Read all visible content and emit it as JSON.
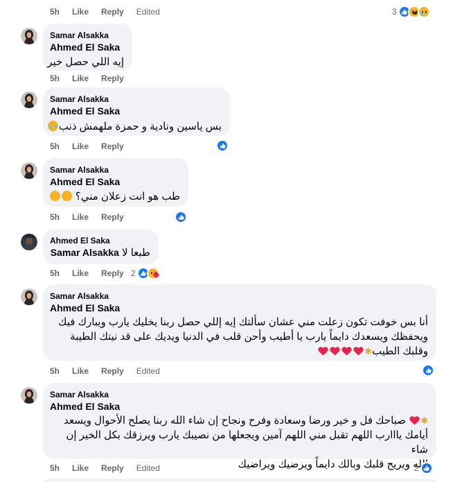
{
  "top_meta": {
    "time": "5h",
    "like": "Like",
    "reply": "Reply",
    "edited": "Edited",
    "count": "3"
  },
  "comments": [
    {
      "author": "Samar Alsakka",
      "reply_to": "Ahmed El Saka",
      "text": "إيه اللي حصل خير",
      "time": "5h",
      "like": "Like",
      "reply": "Reply"
    },
    {
      "author": "Samar Alsakka",
      "reply_to": "Ahmed El Saka",
      "text": "بس ياسين ونادية و حمزة ملهمش ذنب",
      "time": "5h",
      "like": "Like",
      "reply": "Reply"
    },
    {
      "author": "Samar Alsakka",
      "reply_to": "Ahmed El Saka",
      "text": "طب هو انت زعلان مني؟",
      "time": "5h",
      "like": "Like",
      "reply": "Reply"
    },
    {
      "author": "Ahmed El Saka",
      "reply_to": "Samar Alsakka",
      "text": "طبعا لا",
      "time": "5h",
      "like": "Like",
      "reply": "Reply",
      "count": "2"
    },
    {
      "author": "Samar Alsakka",
      "reply_to": "Ahmed El Saka",
      "line1": "أنا بس خوفت تكون زعلت مني عشان سألتك إيه إللي حصل ربنا يخليك يارب ويبارك فيك",
      "line2": "ويحفظك ويسعدك دايماً يارب يا أطيب وأحن قلب في الدنيا ويديك على قد نيتك الطيبة",
      "line3": "وقلبك الطيب",
      "time": "5h",
      "like": "Like",
      "reply": "Reply",
      "edited": "Edited"
    },
    {
      "author": "Samar Alsakka",
      "reply_to": "Ahmed El Saka",
      "line1": "صباحك فل و خير ورضا وسعادة وفرح ونجاح إن شاء الله ربنا يصلح الأحوال ويسعد",
      "line2": "أيامك يااارب اللهم تقبل مني اللهم آمين ويجعلها من نصيبك يارب ويرزقك بكل الخير إن شاء",
      "line3": "الله ويريح قلبك وبالك دايماً ويرضيك ويراضيك",
      "time": "5h",
      "like": "Like",
      "reply": "Reply",
      "edited": "Edited",
      "count": "2"
    }
  ],
  "colors": {
    "bubble": "#f0f2f5",
    "like_blue": "#1877f2",
    "meta_gray": "#65676b",
    "heart_red": "#e4264c"
  }
}
